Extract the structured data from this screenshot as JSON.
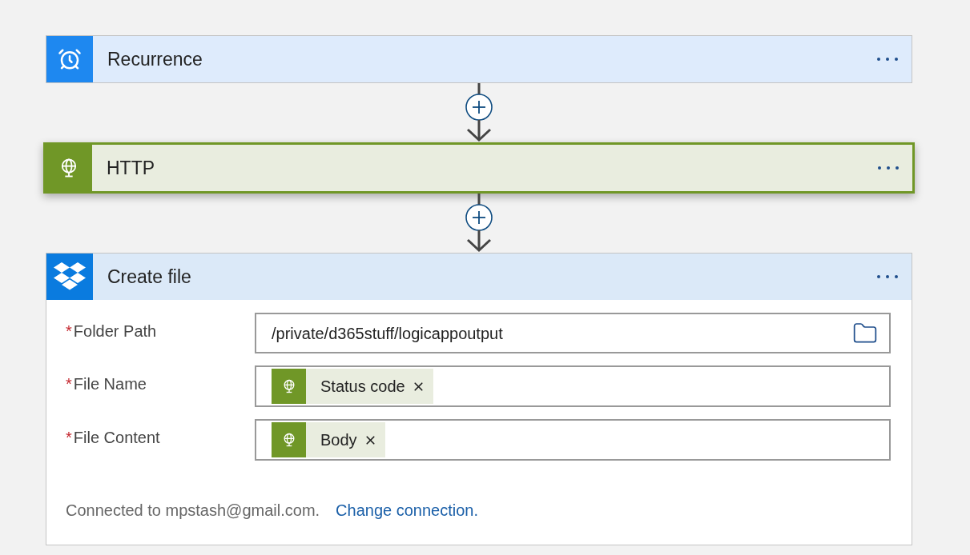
{
  "steps": [
    {
      "kind": "trigger",
      "title": "Recurrence",
      "selected": false
    },
    {
      "kind": "http",
      "title": "HTTP",
      "selected": true
    },
    {
      "kind": "dropbox",
      "title": "Create file",
      "selected": false,
      "fields": [
        {
          "label": "Folder Path",
          "marker": "*",
          "kind": "text",
          "value": "/private/d365stuff/logicappoutput"
        },
        {
          "label": "File Name",
          "marker": "*",
          "kind": "tokens",
          "tokens": [
            "Status code"
          ]
        },
        {
          "label": "File Content",
          "marker": "*",
          "kind": "tokens",
          "tokens": [
            "Body"
          ]
        }
      ],
      "connection": {
        "text": "Connected to mpstash@gmail.com.",
        "link": "Change connection."
      }
    }
  ]
}
